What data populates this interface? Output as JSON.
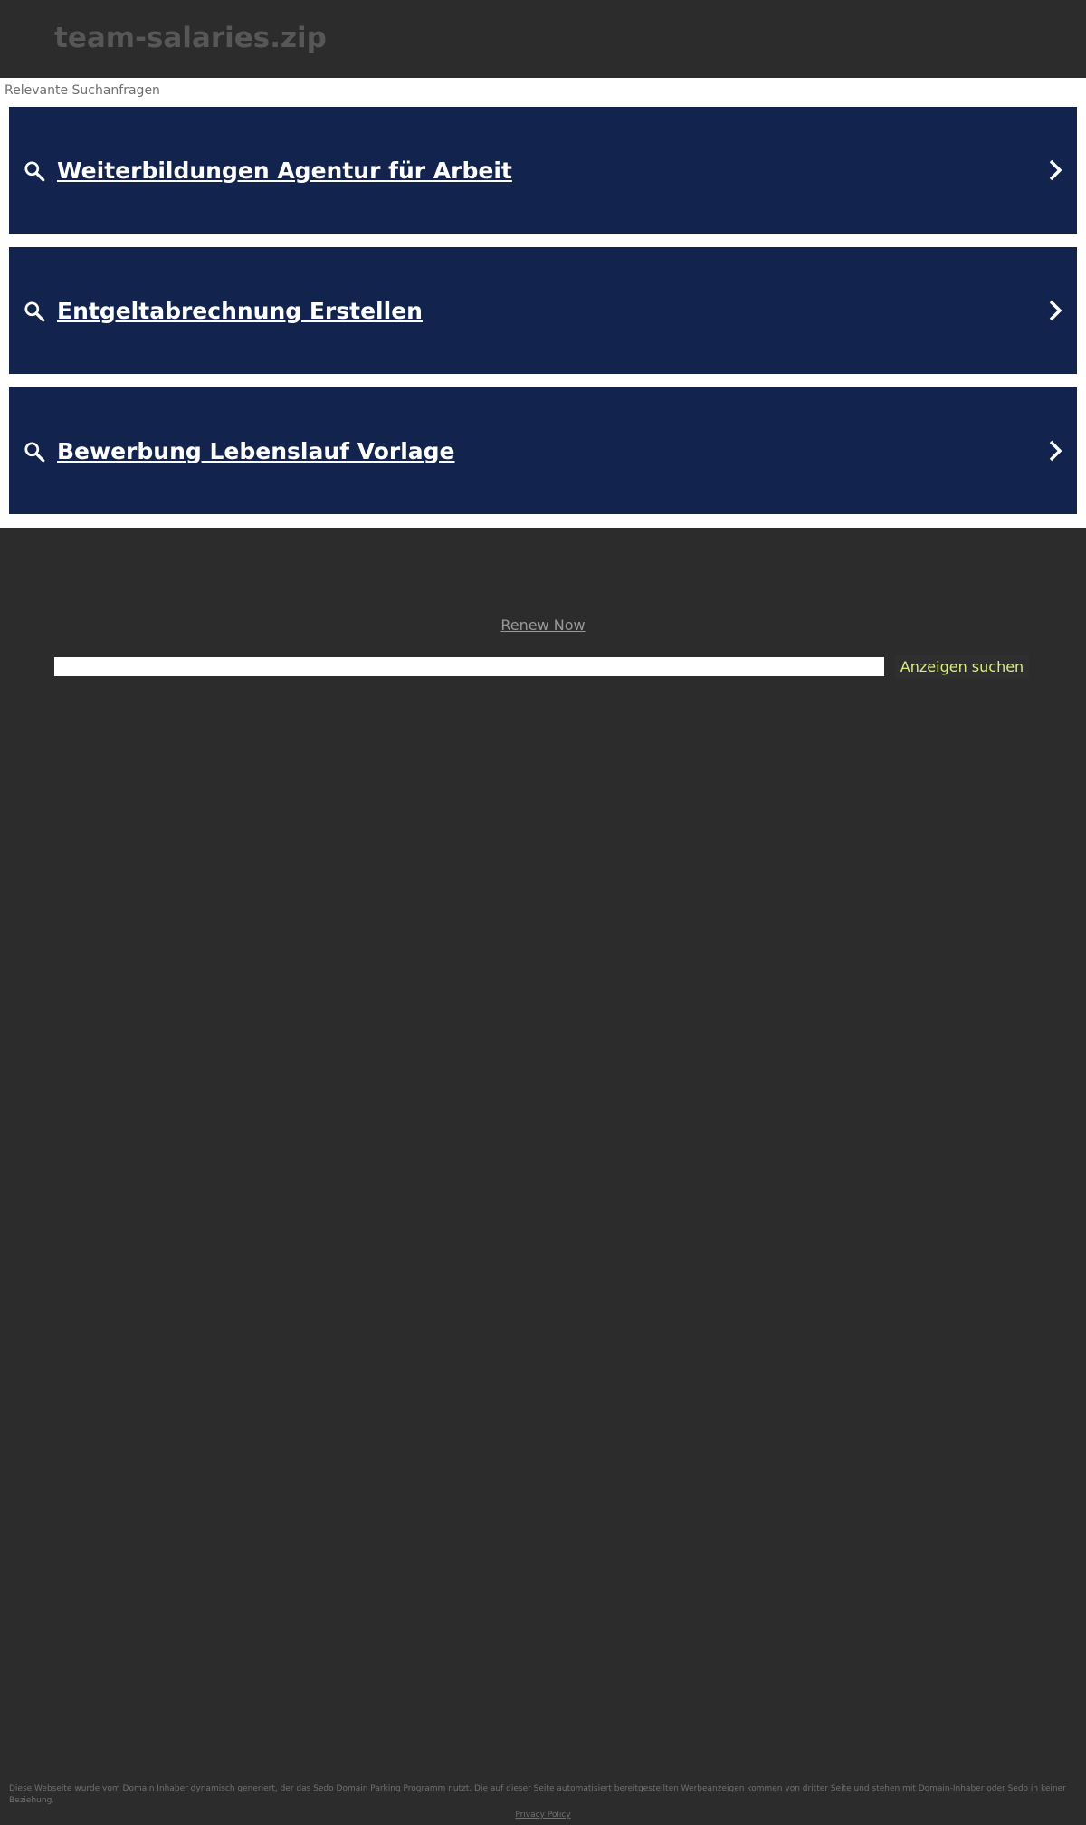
{
  "header": {
    "domain": "team-salaries.zip"
  },
  "ads": {
    "label": "Relevante Suchanfragen",
    "items": [
      {
        "text": "Weiterbildungen Agentur für Arbeit"
      },
      {
        "text": "Entgeltabrechnung Erstellen"
      },
      {
        "text": "Bewerbung Lebenslauf Vorlage"
      }
    ]
  },
  "renew": {
    "label": "Renew Now"
  },
  "search": {
    "value": "",
    "button_label": "Anzeigen suchen"
  },
  "footer": {
    "disclaimer_before": "Diese Webseite wurde vom Domain Inhaber dynamisch generiert, der das Sedo ",
    "disclaimer_link": "Domain Parking Programm",
    "disclaimer_after": " nutzt. Die auf dieser Seite automatisiert bereitgestellten Werbeanzeigen kommen von dritter Seite und stehen mit Domain-Inhaber oder Sedo in keiner Beziehung.",
    "privacy_label": "Privacy Policy"
  },
  "colors": {
    "background": "#2c2c2c",
    "ad_background": "#12234d",
    "button_text": "#d8ee83"
  }
}
